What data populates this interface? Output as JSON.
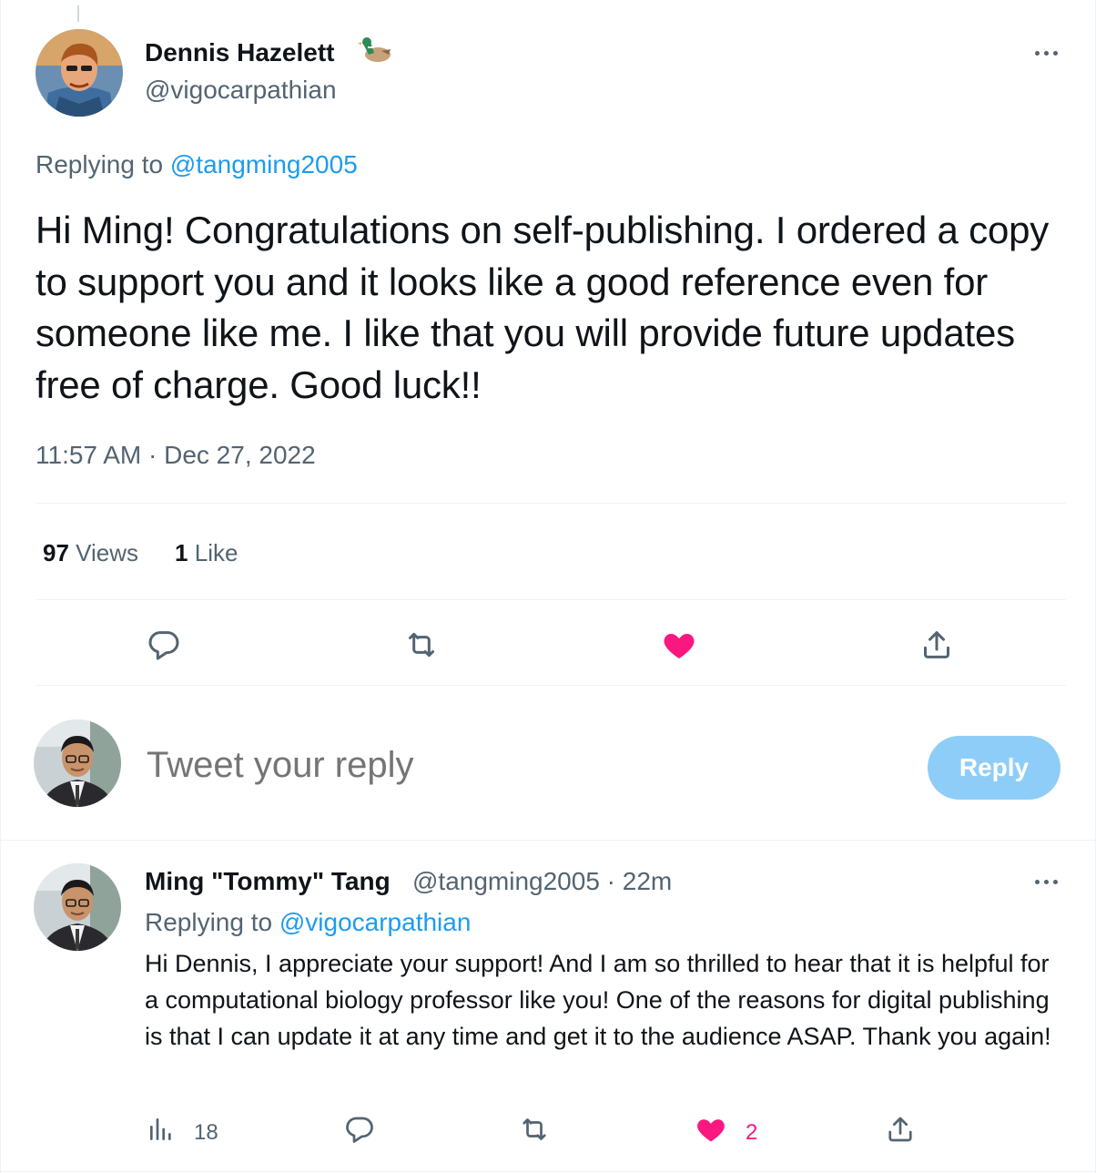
{
  "main_tweet": {
    "author_name": "Dennis Hazelett",
    "author_emoji": "duck-emoji",
    "author_handle": "@vigocarpathian",
    "replying_prefix": "Replying to",
    "replying_to": "@tangming2005",
    "text": "Hi Ming! Congratulations on self-publishing. I ordered a copy to support you and it looks like a good reference even for someone like me. I like that you will provide future updates free of charge. Good luck!!",
    "timestamp": "11:57 AM · Dec 27, 2022",
    "views_count": "97",
    "views_label": "Views",
    "likes_count": "1",
    "likes_label": "Like",
    "liked": true
  },
  "compose": {
    "placeholder": "Tweet your reply",
    "reply_label": "Reply"
  },
  "reply_tweet": {
    "author_name": "Ming \"Tommy\" Tang",
    "author_handle": "@tangming2005 · 22m",
    "replying_prefix": "Replying to",
    "replying_to": "@vigocarpathian",
    "text": "Hi Dennis, I appreciate your support! And I am so thrilled to hear that it is helpful for a computational biology professor like you! One of the reasons for digital publishing is that I can update it at any time and get it to the audience ASAP. Thank you again!",
    "views_count": "18",
    "likes_count": "2",
    "liked": true
  },
  "colors": {
    "accent": "#1d9bf0",
    "like": "#f91880",
    "secondary_text": "#536471",
    "reply_button_disabled": "#8ecdf8"
  },
  "icons": [
    "more-icon",
    "reply-icon",
    "retweet-icon",
    "like-icon",
    "share-icon",
    "views-icon"
  ]
}
